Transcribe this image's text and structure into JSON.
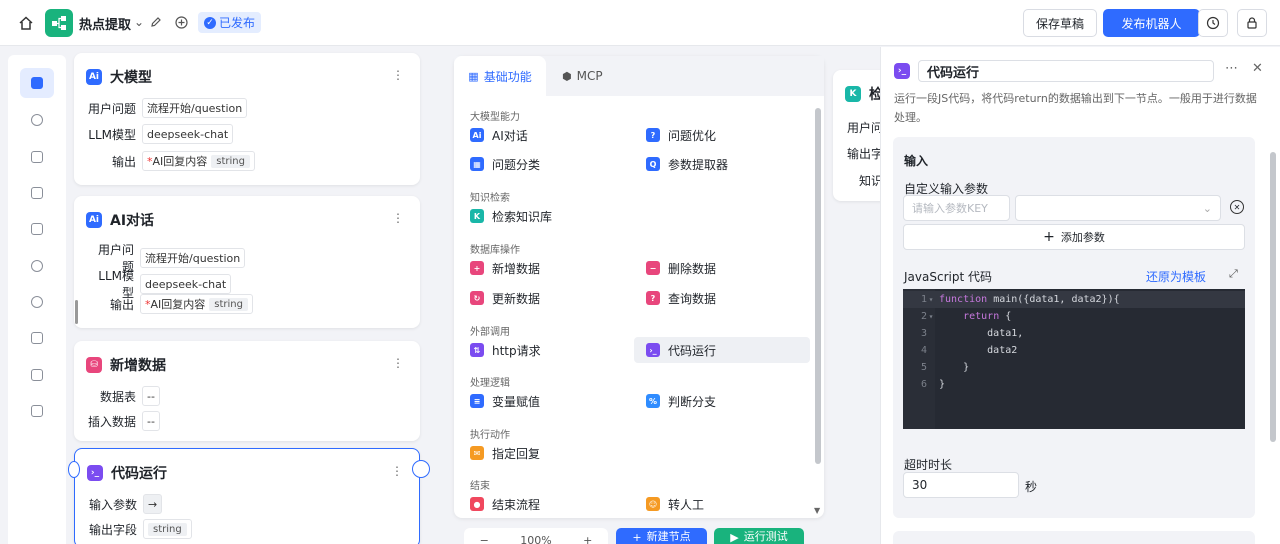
{
  "topbar": {
    "app_name": "热点提取",
    "status": "已发布",
    "save_label": "保存草稿",
    "publish_label": "发布机器人"
  },
  "nodes": [
    {
      "title": "大模型",
      "icon_text": "Ai",
      "color": "#2f6bff",
      "rows": [
        {
          "label": "用户问题",
          "value": "流程开始/question"
        },
        {
          "label": "LLM模型",
          "value": "deepseek-chat"
        },
        {
          "label": "输出",
          "required": "*",
          "value": "AI回复内容",
          "type": "string"
        }
      ]
    },
    {
      "title": "AI对话",
      "icon_text": "Ai",
      "color": "#2f6bff",
      "rows": [
        {
          "label": "用户问题",
          "value": "流程开始/question"
        },
        {
          "label": "LLM模型",
          "value": "deepseek-chat"
        },
        {
          "label": "输出",
          "required": "*",
          "value": "AI回复内容",
          "type": "string"
        }
      ]
    },
    {
      "title": "新增数据",
      "icon_text": "DB",
      "color": "#e8467c",
      "rows": [
        {
          "label": "数据表",
          "value": "--"
        },
        {
          "label": "插入数据",
          "value": "--"
        }
      ]
    },
    {
      "title": "代码运行",
      "icon_text": "</>",
      "color": "#7b4cf0",
      "rows": [
        {
          "label": "输入参数",
          "value": "→"
        },
        {
          "label": "输出字段",
          "value": "string"
        }
      ]
    },
    {
      "title": "检",
      "icon_text": "K",
      "color": "#19b7a8",
      "rows": [
        {
          "label": "用户问"
        },
        {
          "label": "输出字"
        },
        {
          "label": "知识"
        }
      ]
    }
  ],
  "panel": {
    "tabs": [
      "基础功能",
      "MCP"
    ],
    "sections": [
      {
        "label": "大模型能力",
        "items": [
          {
            "label": "AI对话",
            "icon": "ai-chat-icon",
            "color": "#2f6bff",
            "glyph": "Ai"
          },
          {
            "label": "问题优化",
            "icon": "question-optimize-icon",
            "color": "#2f6bff",
            "glyph": "?"
          },
          {
            "label": "问题分类",
            "icon": "classify-icon",
            "color": "#2f6bff",
            "glyph": "▦"
          },
          {
            "label": "参数提取器",
            "icon": "param-extract-icon",
            "color": "#2f6bff",
            "glyph": "Q"
          }
        ]
      },
      {
        "label": "知识检索",
        "items": [
          {
            "label": "检索知识库",
            "icon": "knowledge-search-icon",
            "color": "#19b7a8",
            "glyph": "K"
          }
        ]
      },
      {
        "label": "数据库操作",
        "items": [
          {
            "label": "新增数据",
            "icon": "db-add-icon",
            "color": "#e8467c",
            "glyph": "+"
          },
          {
            "label": "删除数据",
            "icon": "db-delete-icon",
            "color": "#e8467c",
            "glyph": "−"
          },
          {
            "label": "更新数据",
            "icon": "db-update-icon",
            "color": "#e8467c",
            "glyph": "↻"
          },
          {
            "label": "查询数据",
            "icon": "db-query-icon",
            "color": "#e8467c",
            "glyph": "?"
          }
        ]
      },
      {
        "label": "外部调用",
        "items": [
          {
            "label": "http请求",
            "icon": "http-request-icon",
            "color": "#7b4cf0",
            "glyph": "⇅"
          },
          {
            "label": "代码运行",
            "icon": "code-run-icon",
            "color": "#7b4cf0",
            "glyph": "›_"
          }
        ]
      },
      {
        "label": "处理逻辑",
        "items": [
          {
            "label": "变量赋值",
            "icon": "variable-assign-icon",
            "color": "#2f6bff",
            "glyph": "≡"
          },
          {
            "label": "判断分支",
            "icon": "branch-icon",
            "color": "#2f8cff",
            "glyph": "%"
          }
        ]
      },
      {
        "label": "执行动作",
        "items": [
          {
            "label": "指定回复",
            "icon": "reply-icon",
            "color": "#f59a23",
            "glyph": "✉"
          }
        ]
      },
      {
        "label": "结束",
        "items": [
          {
            "label": "结束流程",
            "icon": "end-flow-icon",
            "color": "#f0485e",
            "glyph": "●"
          },
          {
            "label": "转人工",
            "icon": "human-transfer-icon",
            "color": "#f59a23",
            "glyph": "☺"
          }
        ]
      }
    ]
  },
  "bottom": {
    "zoom": "100%",
    "new_node": "新建节点",
    "run_test": "运行测试"
  },
  "detail": {
    "title": "代码运行",
    "desc": "运行一段JS代码，将代码return的数据输出到下一节点。一般用于进行数据处理。",
    "input_title": "输入",
    "custom_params_label": "自定义输入参数",
    "param_key_placeholder": "请输入参数KEY",
    "add_param": "添加参数",
    "code_label": "JavaScript 代码",
    "reset_template": "还原为模板",
    "code_lines": [
      "function main({data1, data2}){",
      "    return {",
      "        data1,",
      "        data2",
      "    }",
      "}"
    ],
    "timeout_label": "超时时长",
    "timeout_value": "30",
    "timeout_unit": "秒"
  }
}
